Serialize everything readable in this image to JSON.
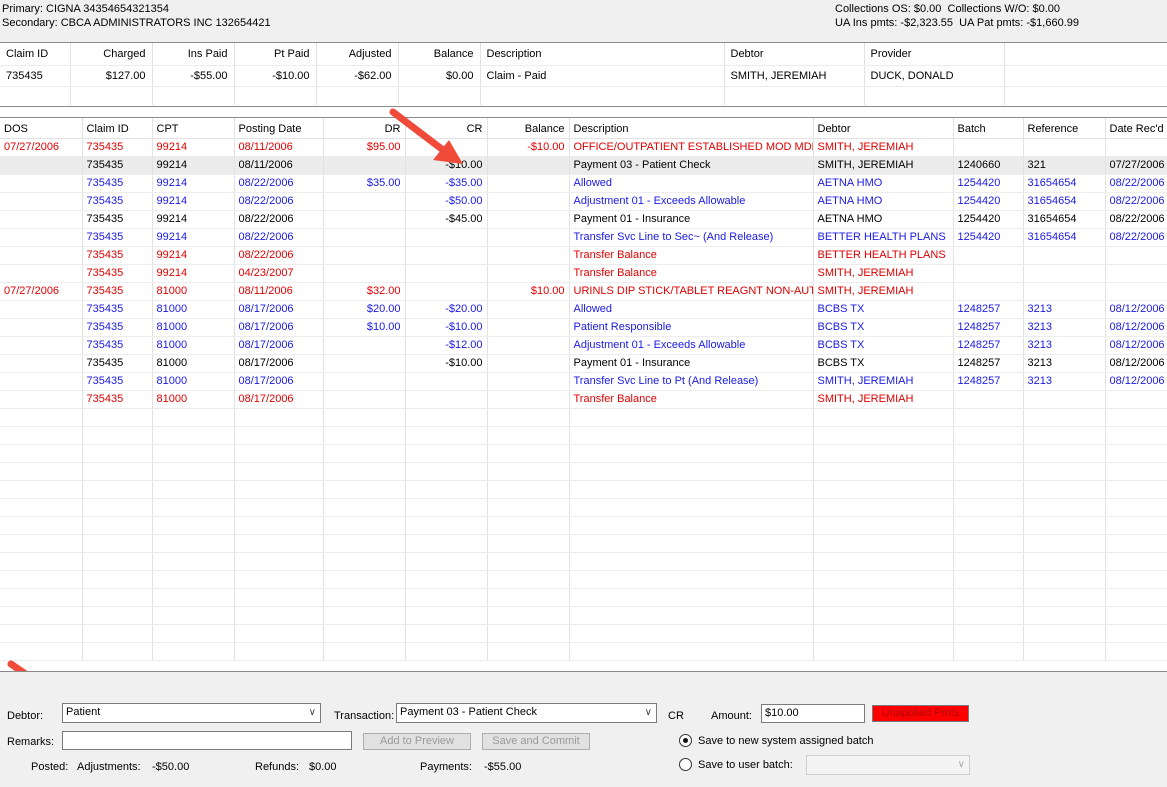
{
  "header": {
    "primary": "Primary: CIGNA 34354654321354",
    "secondary": "Secondary: CBCA ADMINISTRATORS INC 132654421",
    "collections_os": "Collections OS: $0.00",
    "collections_wo": "Collections W/O: $0.00",
    "ua_ins_pmts": "UA Ins pmts: -$2,323.55",
    "ua_pat_pmts": "UA Pat pmts: -$1,660.99"
  },
  "claim": {
    "columns": [
      "Claim ID",
      "Charged",
      "Ins Paid",
      "Pt Paid",
      "Adjusted",
      "Balance",
      "Description",
      "Debtor",
      "Provider"
    ],
    "row": [
      "735435",
      "$127.00",
      "-$55.00",
      "-$10.00",
      "-$62.00",
      "$0.00",
      "Claim - Paid",
      "SMITH, JEREMIAH",
      "DUCK, DONALD"
    ]
  },
  "grid": {
    "columns": [
      "DOS",
      "Claim ID",
      "CPT",
      "Posting Date",
      "DR",
      "CR",
      "Balance",
      "Description",
      "Debtor",
      "Batch",
      "Reference",
      "Date Rec'd"
    ],
    "rows": [
      {
        "color": "red",
        "cells": [
          "07/27/2006",
          "735435",
          "99214",
          "08/11/2006",
          "$95.00",
          "",
          "-$10.00",
          "OFFICE/OUTPATIENT ESTABLISHED MOD MDM...",
          "SMITH, JEREMIAH",
          "",
          "",
          ""
        ]
      },
      {
        "color": "blk",
        "selected": true,
        "cells": [
          "",
          "735435",
          "99214",
          "08/11/2006",
          "",
          "-$10.00",
          "",
          "Payment 03 - Patient Check",
          "SMITH, JEREMIAH",
          "1240660",
          "321",
          "07/27/2006"
        ]
      },
      {
        "color": "blue",
        "cells": [
          "",
          "735435",
          "99214",
          "08/22/2006",
          "$35.00",
          "-$35.00",
          "",
          "Allowed",
          "AETNA HMO",
          "1254420",
          "31654654",
          "08/22/2006"
        ]
      },
      {
        "color": "blue",
        "cells": [
          "",
          "735435",
          "99214",
          "08/22/2006",
          "",
          "-$50.00",
          "",
          "Adjustment 01 - Exceeds Allowable",
          "AETNA HMO",
          "1254420",
          "31654654",
          "08/22/2006"
        ]
      },
      {
        "color": "blk",
        "cells": [
          "",
          "735435",
          "99214",
          "08/22/2006",
          "",
          "-$45.00",
          "",
          "Payment 01 - Insurance",
          "AETNA HMO",
          "1254420",
          "31654654",
          "08/22/2006"
        ]
      },
      {
        "color": "blue",
        "cells": [
          "",
          "735435",
          "99214",
          "08/22/2006",
          "",
          "",
          "",
          "Transfer Svc Line to Sec~ (And Release)",
          "BETTER HEALTH PLANS",
          "1254420",
          "31654654",
          "08/22/2006"
        ]
      },
      {
        "color": "red",
        "cells": [
          "",
          "735435",
          "99214",
          "08/22/2006",
          "",
          "",
          "",
          "Transfer Balance",
          "BETTER HEALTH PLANS",
          "",
          "",
          ""
        ]
      },
      {
        "color": "red",
        "cells": [
          "",
          "735435",
          "99214",
          "04/23/2007",
          "",
          "",
          "",
          "Transfer Balance",
          "SMITH, JEREMIAH",
          "",
          "",
          ""
        ]
      },
      {
        "color": "red",
        "cells": [
          "07/27/2006",
          "735435",
          "81000",
          "08/11/2006",
          "$32.00",
          "",
          "$10.00",
          "URINLS DIP STICK/TABLET REAGNT NON-AUT...",
          "SMITH, JEREMIAH",
          "",
          "",
          ""
        ]
      },
      {
        "color": "blue",
        "cells": [
          "",
          "735435",
          "81000",
          "08/17/2006",
          "$20.00",
          "-$20.00",
          "",
          "Allowed",
          "BCBS TX",
          "1248257",
          "3213",
          "08/12/2006"
        ]
      },
      {
        "color": "blue",
        "cells": [
          "",
          "735435",
          "81000",
          "08/17/2006",
          "$10.00",
          "-$10.00",
          "",
          "Patient Responsible",
          "BCBS TX",
          "1248257",
          "3213",
          "08/12/2006"
        ]
      },
      {
        "color": "blue",
        "cells": [
          "",
          "735435",
          "81000",
          "08/17/2006",
          "",
          "-$12.00",
          "",
          "Adjustment 01 - Exceeds Allowable",
          "BCBS TX",
          "1248257",
          "3213",
          "08/12/2006"
        ]
      },
      {
        "color": "blk",
        "cells": [
          "",
          "735435",
          "81000",
          "08/17/2006",
          "",
          "-$10.00",
          "",
          "Payment 01 - Insurance",
          "BCBS TX",
          "1248257",
          "3213",
          "08/12/2006"
        ]
      },
      {
        "color": "blue",
        "cells": [
          "",
          "735435",
          "81000",
          "08/17/2006",
          "",
          "",
          "",
          "Transfer Svc Line to Pt (And Release)",
          "SMITH, JEREMIAH",
          "1248257",
          "3213",
          "08/12/2006"
        ]
      },
      {
        "color": "red",
        "cells": [
          "",
          "735435",
          "81000",
          "08/17/2006",
          "",
          "",
          "",
          "Transfer Balance",
          "SMITH, JEREMIAH",
          "",
          "",
          ""
        ]
      }
    ]
  },
  "form": {
    "debtor_label": "Debtor:",
    "debtor_value": "Patient",
    "transaction_label": "Transaction:",
    "transaction_value": "Payment 03 - Patient Check",
    "cr_label": "CR",
    "amount_label": "Amount:",
    "amount_value": "$10.00",
    "unapplied_label": "Unapplied Pmts",
    "remarks_label": "Remarks:",
    "remarks_value": "",
    "add_preview": "Add to Preview",
    "save_commit": "Save and Commit",
    "radio_new_batch": "Save to new system assigned batch",
    "radio_user_batch": "Save to user batch:",
    "user_batch_value": "",
    "posted_label": "Posted:",
    "adjustments_label": "Adjustments:",
    "adjustments_value": "-$50.00",
    "refunds_label": "Refunds:",
    "refunds_value": "$0.00",
    "payments_label": "Payments:",
    "payments_value": "-$55.00"
  },
  "colors": {
    "red": "#e00000",
    "blue": "#1a1ae6",
    "unapplied": "#ff0000",
    "arrow": "#f04a3a"
  },
  "icons": [
    "chevron-down-icon",
    "callout-arrow-icon"
  ]
}
